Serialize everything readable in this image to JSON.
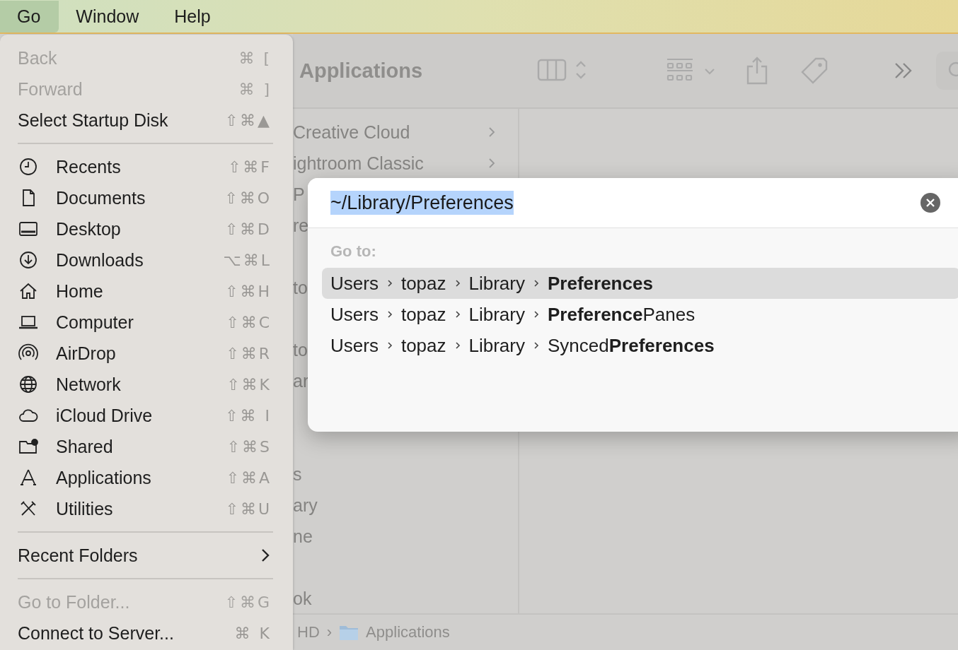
{
  "menubar": [
    {
      "label": "Go",
      "selected": true
    },
    {
      "label": "Window",
      "selected": false
    },
    {
      "label": "Help",
      "selected": false
    }
  ],
  "go_menu": [
    {
      "kind": "item",
      "label": "Back",
      "shortcut": "⌘ [",
      "disabled": true
    },
    {
      "kind": "item",
      "label": "Forward",
      "shortcut": "⌘ ]",
      "disabled": true
    },
    {
      "kind": "item",
      "label": "Select Startup Disk",
      "shortcut": "⇧⌘▲",
      "disabled": false
    },
    {
      "kind": "separator"
    },
    {
      "kind": "icon_item",
      "label": "Recents",
      "shortcut": "⇧⌘F",
      "disabled": false
    },
    {
      "kind": "icon_item",
      "label": "Documents",
      "shortcut": "⇧⌘O",
      "disabled": false
    },
    {
      "kind": "icon_item",
      "label": "Desktop",
      "shortcut": "⇧⌘D",
      "disabled": false
    },
    {
      "kind": "icon_item",
      "label": "Downloads",
      "shortcut": "⌥⌘L",
      "disabled": false
    },
    {
      "kind": "icon_item",
      "label": "Home",
      "shortcut": "⇧⌘H",
      "disabled": false
    },
    {
      "kind": "icon_item",
      "label": "Computer",
      "shortcut": "⇧⌘C",
      "disabled": false
    },
    {
      "kind": "icon_item",
      "label": "AirDrop",
      "shortcut": "⇧⌘R",
      "disabled": false
    },
    {
      "kind": "icon_item",
      "label": "Network",
      "shortcut": "⇧⌘K",
      "disabled": false
    },
    {
      "kind": "icon_item",
      "label": "iCloud Drive",
      "shortcut": "⇧⌘ I",
      "disabled": false
    },
    {
      "kind": "icon_item",
      "label": "Shared",
      "shortcut": "⇧⌘S",
      "disabled": false
    },
    {
      "kind": "icon_item",
      "label": "Applications",
      "shortcut": "⇧⌘A",
      "disabled": false
    },
    {
      "kind": "icon_item",
      "label": "Utilities",
      "shortcut": "⇧⌘U",
      "disabled": false
    },
    {
      "kind": "separator"
    },
    {
      "kind": "submenu",
      "label": "Recent Folders",
      "disabled": false
    },
    {
      "kind": "separator"
    },
    {
      "kind": "item",
      "label": "Go to Folder...",
      "shortcut": "⇧⌘G",
      "disabled": true
    },
    {
      "kind": "item",
      "label": "Connect to Server...",
      "shortcut": "⌘ K",
      "disabled": false
    }
  ],
  "finder": {
    "title": "Applications",
    "list": [
      {
        "label": "Creative Cloud",
        "has_children": true
      },
      {
        "label": "ightroom Classic",
        "has_children": true
      },
      {
        "label": "P"
      },
      {
        "label": "re"
      },
      {
        "label": "to"
      },
      {
        "label": "to"
      },
      {
        "label": "ar"
      },
      {
        "label": "s"
      },
      {
        "label": "ary"
      },
      {
        "label": "ne"
      },
      {
        "label": "ok"
      }
    ],
    "path_bar": [
      {
        "label": "HD"
      },
      {
        "separator": "›",
        "label": "Applications"
      }
    ]
  },
  "go_to_dialog": {
    "value": "~/Library/Preferences",
    "section_label": "Go to:",
    "suggestions": [
      {
        "segments": [
          "Users",
          "topaz",
          "Library",
          "**Preferences**"
        ],
        "selected": true
      },
      {
        "segments": [
          "Users",
          "topaz",
          "Library",
          "**Preference**Panes"
        ],
        "selected": false
      },
      {
        "segments": [
          "Users",
          "topaz",
          "Library",
          "Synced**Preferences**"
        ],
        "selected": false
      }
    ]
  }
}
